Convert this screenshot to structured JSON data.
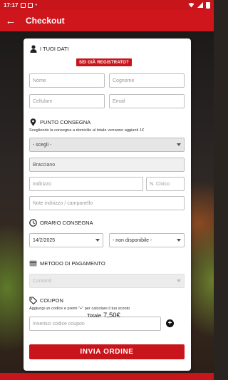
{
  "status_bar": {
    "time": "17:17"
  },
  "app_bar": {
    "title": "Checkout"
  },
  "your_data": {
    "heading": "I TUOI DATI",
    "registered_button": "SEI GIÀ REGISTRATO?",
    "name_placeholder": "Nome",
    "surname_placeholder": "Cognome",
    "phone_placeholder": "Cellulare",
    "email_placeholder": "Email"
  },
  "delivery": {
    "heading": "PUNTO CONSEGNA",
    "note": "Scegliendo la consegna a domicilio al totale verranno aggiunti 1€",
    "select_value": "- scegli -",
    "city": "Bracciano",
    "address_placeholder": "Indirizzo",
    "number_placeholder": "N. Civico",
    "notes_placeholder": "Note indirizzo / campanello"
  },
  "schedule": {
    "heading": "ORARIO CONSEGNA",
    "date": "14/2/2025",
    "time_value": "- non disponibile -"
  },
  "payment": {
    "heading": "METODO DI PAGAMENTO",
    "method": "Contanti"
  },
  "coupon": {
    "heading": "COUPON",
    "note": "Aggiungi un codice e premi \"+\" per calcolare il tuo sconto",
    "placeholder": "Inserisci codice coupon"
  },
  "total": {
    "label": "Totale",
    "amount": "7,50€"
  },
  "submit_label": "INVIA ORDINE"
}
